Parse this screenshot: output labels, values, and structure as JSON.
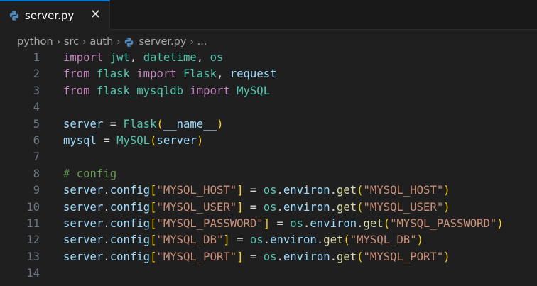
{
  "tab": {
    "title": "server.py",
    "close_glyph": "✕",
    "icon": "python-icon"
  },
  "breadcrumb": {
    "items": [
      "python",
      "src",
      "auth",
      "server.py",
      "..."
    ],
    "separator": "›"
  },
  "colors": {
    "keyword": "#c586c0",
    "variable": "#9cdcfe",
    "class": "#4ec9b0",
    "string": "#ce9178",
    "function": "#dcdcaa",
    "comment": "#6a9955",
    "bracket1": "#ffd700",
    "bracket2": "#da70d6",
    "accent": "#0078d4"
  },
  "editor": {
    "lines": [
      {
        "n": "1",
        "tokens": [
          {
            "t": "import",
            "c": "kw"
          },
          {
            "t": " ",
            "c": "pl"
          },
          {
            "t": "jwt",
            "c": "mod"
          },
          {
            "t": ", ",
            "c": "pl"
          },
          {
            "t": "datetime",
            "c": "mod"
          },
          {
            "t": ", ",
            "c": "pl"
          },
          {
            "t": "os",
            "c": "mod"
          }
        ]
      },
      {
        "n": "2",
        "tokens": [
          {
            "t": "from",
            "c": "kw"
          },
          {
            "t": " ",
            "c": "pl"
          },
          {
            "t": "flask",
            "c": "mod"
          },
          {
            "t": " ",
            "c": "pl"
          },
          {
            "t": "import",
            "c": "kw"
          },
          {
            "t": " ",
            "c": "pl"
          },
          {
            "t": "Flask",
            "c": "mod"
          },
          {
            "t": ", ",
            "c": "pl"
          },
          {
            "t": "request",
            "c": "id"
          }
        ]
      },
      {
        "n": "3",
        "tokens": [
          {
            "t": "from",
            "c": "kw"
          },
          {
            "t": " ",
            "c": "pl"
          },
          {
            "t": "flask_mysqldb",
            "c": "mod"
          },
          {
            "t": " ",
            "c": "pl"
          },
          {
            "t": "import",
            "c": "kw"
          },
          {
            "t": " ",
            "c": "pl"
          },
          {
            "t": "MySQL",
            "c": "mod"
          }
        ]
      },
      {
        "n": "4",
        "tokens": []
      },
      {
        "n": "5",
        "tokens": [
          {
            "t": "server",
            "c": "id"
          },
          {
            "t": " = ",
            "c": "pl"
          },
          {
            "t": "Flask",
            "c": "mod"
          },
          {
            "t": "(",
            "c": "b1"
          },
          {
            "t": "__name__",
            "c": "id"
          },
          {
            "t": ")",
            "c": "b1"
          }
        ]
      },
      {
        "n": "6",
        "tokens": [
          {
            "t": "mysql",
            "c": "id"
          },
          {
            "t": " = ",
            "c": "pl"
          },
          {
            "t": "MySQL",
            "c": "mod"
          },
          {
            "t": "(",
            "c": "b1"
          },
          {
            "t": "server",
            "c": "id"
          },
          {
            "t": ")",
            "c": "b1"
          }
        ]
      },
      {
        "n": "7",
        "tokens": []
      },
      {
        "n": "8",
        "tokens": [
          {
            "t": "# config",
            "c": "cm"
          }
        ]
      },
      {
        "n": "9",
        "tokens": [
          {
            "t": "server",
            "c": "id"
          },
          {
            "t": ".",
            "c": "pl"
          },
          {
            "t": "config",
            "c": "id"
          },
          {
            "t": "[",
            "c": "b1"
          },
          {
            "t": "\"MYSQL_HOST\"",
            "c": "str"
          },
          {
            "t": "]",
            "c": "b1"
          },
          {
            "t": " = ",
            "c": "pl"
          },
          {
            "t": "os",
            "c": "mod"
          },
          {
            "t": ".",
            "c": "pl"
          },
          {
            "t": "environ",
            "c": "id"
          },
          {
            "t": ".",
            "c": "pl"
          },
          {
            "t": "get",
            "c": "fn"
          },
          {
            "t": "(",
            "c": "b1"
          },
          {
            "t": "\"MYSQL_HOST\"",
            "c": "str"
          },
          {
            "t": ")",
            "c": "b1"
          }
        ]
      },
      {
        "n": "10",
        "tokens": [
          {
            "t": "server",
            "c": "id"
          },
          {
            "t": ".",
            "c": "pl"
          },
          {
            "t": "config",
            "c": "id"
          },
          {
            "t": "[",
            "c": "b1"
          },
          {
            "t": "\"MYSQL_USER\"",
            "c": "str"
          },
          {
            "t": "]",
            "c": "b1"
          },
          {
            "t": " = ",
            "c": "pl"
          },
          {
            "t": "os",
            "c": "mod"
          },
          {
            "t": ".",
            "c": "pl"
          },
          {
            "t": "environ",
            "c": "id"
          },
          {
            "t": ".",
            "c": "pl"
          },
          {
            "t": "get",
            "c": "fn"
          },
          {
            "t": "(",
            "c": "b1"
          },
          {
            "t": "\"MYSQL_USER\"",
            "c": "str"
          },
          {
            "t": ")",
            "c": "b1"
          }
        ]
      },
      {
        "n": "11",
        "tokens": [
          {
            "t": "server",
            "c": "id"
          },
          {
            "t": ".",
            "c": "pl"
          },
          {
            "t": "config",
            "c": "id"
          },
          {
            "t": "[",
            "c": "b1"
          },
          {
            "t": "\"MYSQL_PASSWORD\"",
            "c": "str"
          },
          {
            "t": "]",
            "c": "b1"
          },
          {
            "t": " = ",
            "c": "pl"
          },
          {
            "t": "os",
            "c": "mod"
          },
          {
            "t": ".",
            "c": "pl"
          },
          {
            "t": "environ",
            "c": "id"
          },
          {
            "t": ".",
            "c": "pl"
          },
          {
            "t": "get",
            "c": "fn"
          },
          {
            "t": "(",
            "c": "b1"
          },
          {
            "t": "\"MYSQL_PASSWORD\"",
            "c": "str"
          },
          {
            "t": ")",
            "c": "b1"
          }
        ]
      },
      {
        "n": "12",
        "tokens": [
          {
            "t": "server",
            "c": "id"
          },
          {
            "t": ".",
            "c": "pl"
          },
          {
            "t": "config",
            "c": "id"
          },
          {
            "t": "[",
            "c": "b1"
          },
          {
            "t": "\"MYSQL_DB\"",
            "c": "str"
          },
          {
            "t": "]",
            "c": "b1"
          },
          {
            "t": " = ",
            "c": "pl"
          },
          {
            "t": "os",
            "c": "mod"
          },
          {
            "t": ".",
            "c": "pl"
          },
          {
            "t": "environ",
            "c": "id"
          },
          {
            "t": ".",
            "c": "pl"
          },
          {
            "t": "get",
            "c": "fn"
          },
          {
            "t": "(",
            "c": "b1"
          },
          {
            "t": "\"MYSQL_DB\"",
            "c": "str"
          },
          {
            "t": ")",
            "c": "b1"
          }
        ]
      },
      {
        "n": "13",
        "tokens": [
          {
            "t": "server",
            "c": "id"
          },
          {
            "t": ".",
            "c": "pl"
          },
          {
            "t": "config",
            "c": "id"
          },
          {
            "t": "[",
            "c": "b1"
          },
          {
            "t": "\"MYSQL_PORT\"",
            "c": "str"
          },
          {
            "t": "]",
            "c": "b1"
          },
          {
            "t": " = ",
            "c": "pl"
          },
          {
            "t": "os",
            "c": "mod"
          },
          {
            "t": ".",
            "c": "pl"
          },
          {
            "t": "environ",
            "c": "id"
          },
          {
            "t": ".",
            "c": "pl"
          },
          {
            "t": "get",
            "c": "fn"
          },
          {
            "t": "(",
            "c": "b1"
          },
          {
            "t": "\"MYSQL_PORT\"",
            "c": "str"
          },
          {
            "t": ")",
            "c": "b1"
          }
        ]
      },
      {
        "n": "14",
        "tokens": []
      }
    ]
  }
}
